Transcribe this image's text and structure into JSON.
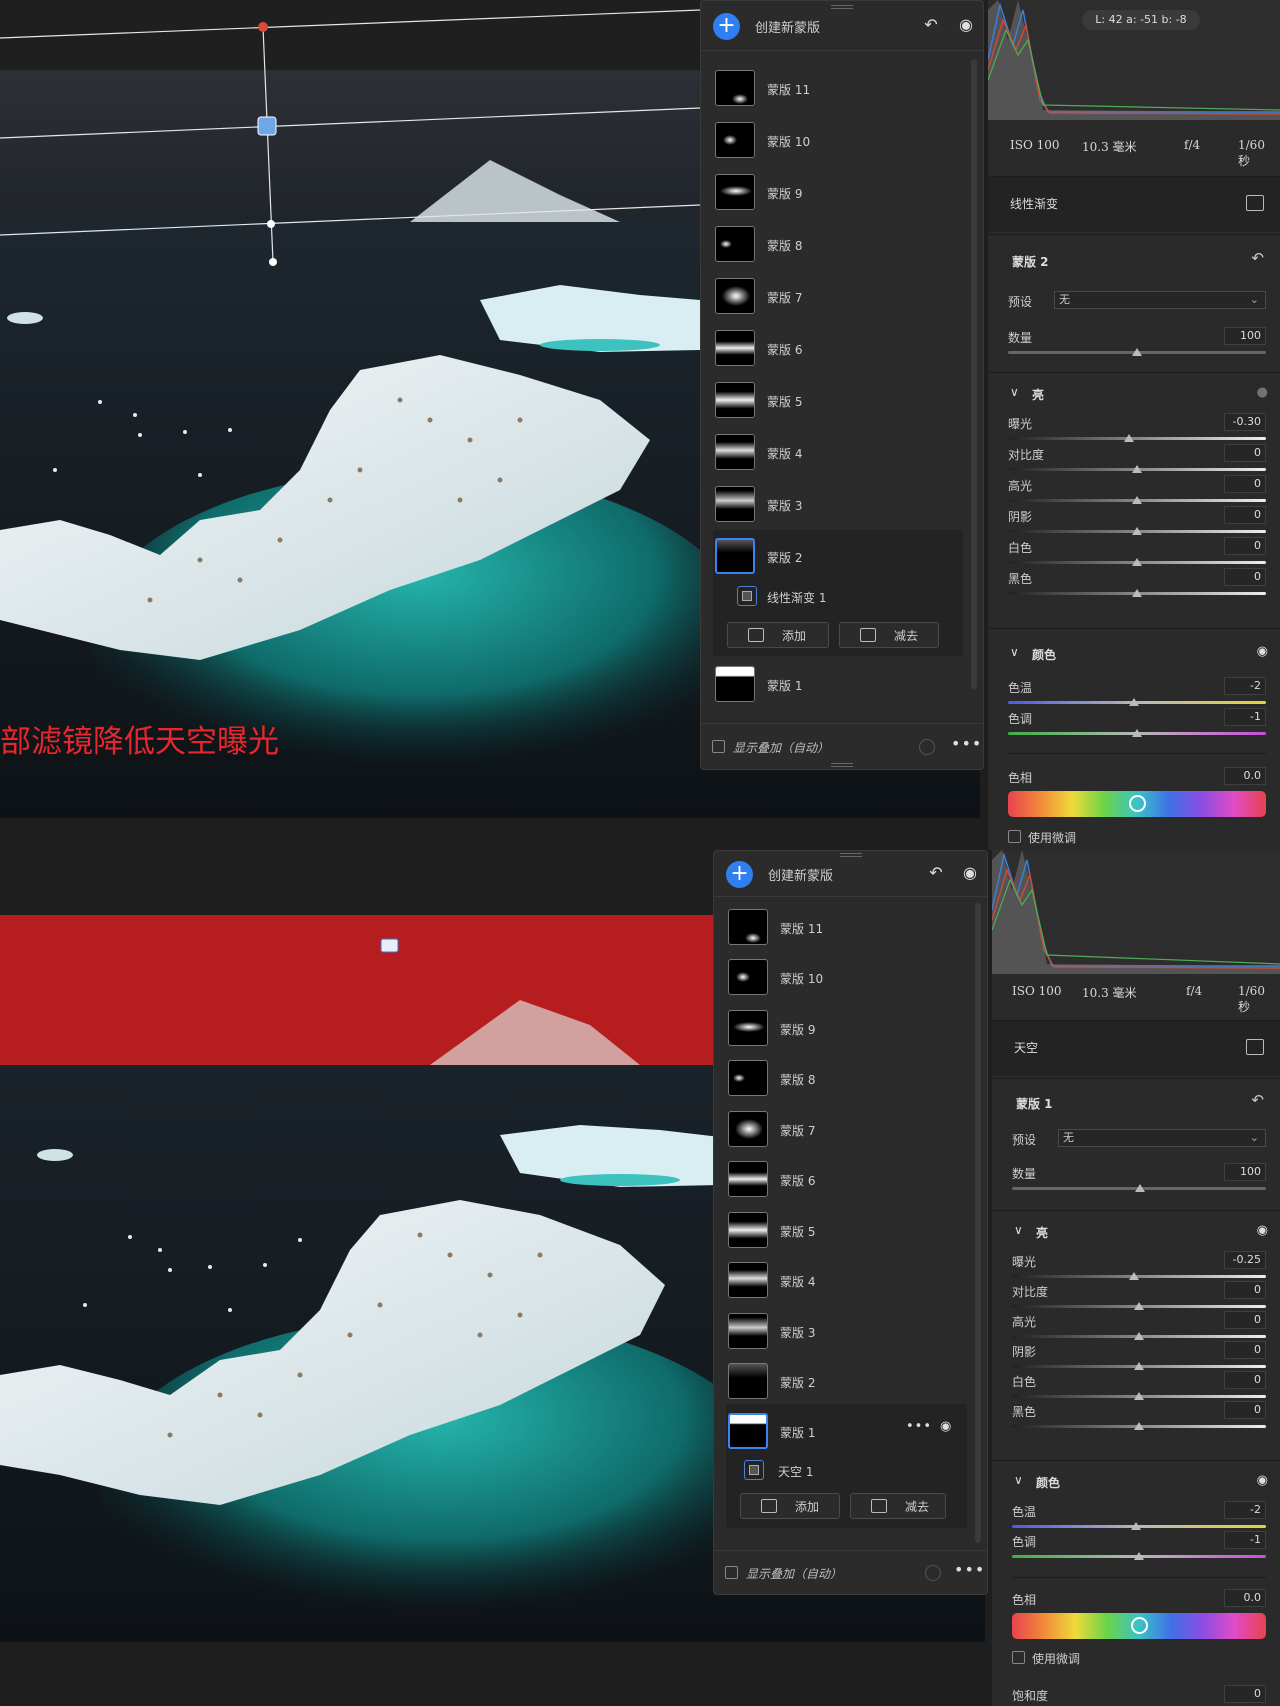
{
  "top": {
    "caption": "部滤镜降低天空曝光",
    "mask_panel": {
      "title": "创建新蒙版",
      "masks": [
        "蒙版 11",
        "蒙版 10",
        "蒙版 9",
        "蒙版 8",
        "蒙版 7",
        "蒙版 6",
        "蒙版 5",
        "蒙版 4",
        "蒙版 3",
        "蒙版 2",
        "蒙版 1"
      ],
      "selected_mask": "蒙版 2",
      "sub_item": "线性渐变 1",
      "add_label": "添加",
      "subtract_label": "减去",
      "overlay_label": "显示叠加（自动）"
    },
    "right": {
      "lab_readout": "L: 42   a: -51   b: -8",
      "exif": {
        "iso": "ISO 100",
        "focal": "10.3 毫米",
        "aperture": "f/4",
        "shutter": "1/60 秒"
      },
      "tool_name": "线性渐变",
      "mask_name": "蒙版 2",
      "preset_label": "预设",
      "preset_value": "无",
      "amount_label": "数量",
      "amount_value": "100",
      "light_section": "亮",
      "light": [
        {
          "label": "曝光",
          "value": "-0.30",
          "pos": 0.47
        },
        {
          "label": "对比度",
          "value": "0",
          "pos": 0.5
        },
        {
          "label": "高光",
          "value": "0",
          "pos": 0.5
        },
        {
          "label": "阴影",
          "value": "0",
          "pos": 0.5
        },
        {
          "label": "白色",
          "value": "0",
          "pos": 0.5
        },
        {
          "label": "黑色",
          "value": "0",
          "pos": 0.5
        }
      ],
      "color_section": "颜色",
      "color": [
        {
          "label": "色温",
          "value": "-2",
          "pos": 0.49
        },
        {
          "label": "色调",
          "value": "-1",
          "pos": 0.5
        }
      ],
      "hue_label": "色相",
      "hue_value": "0.0",
      "fine_tune_label": "使用微调"
    }
  },
  "bottom": {
    "mask_panel": {
      "title": "创建新蒙版",
      "masks": [
        "蒙版 11",
        "蒙版 10",
        "蒙版 9",
        "蒙版 8",
        "蒙版 7",
        "蒙版 6",
        "蒙版 5",
        "蒙版 4",
        "蒙版 3",
        "蒙版 2",
        "蒙版 1"
      ],
      "selected_mask": "蒙版 1",
      "sub_item": "天空 1",
      "add_label": "添加",
      "subtract_label": "减去",
      "overlay_label": "显示叠加（自动）"
    },
    "right": {
      "exif": {
        "iso": "ISO 100",
        "focal": "10.3 毫米",
        "aperture": "f/4",
        "shutter": "1/60 秒"
      },
      "tool_name": "天空",
      "mask_name": "蒙版 1",
      "preset_label": "预设",
      "preset_value": "无",
      "amount_label": "数量",
      "amount_value": "100",
      "light_section": "亮",
      "light": [
        {
          "label": "曝光",
          "value": "-0.25",
          "pos": 0.48
        },
        {
          "label": "对比度",
          "value": "0",
          "pos": 0.5
        },
        {
          "label": "高光",
          "value": "0",
          "pos": 0.5
        },
        {
          "label": "阴影",
          "value": "0",
          "pos": 0.5
        },
        {
          "label": "白色",
          "value": "0",
          "pos": 0.5
        },
        {
          "label": "黑色",
          "value": "0",
          "pos": 0.5
        }
      ],
      "color_section": "颜色",
      "color": [
        {
          "label": "色温",
          "value": "-2",
          "pos": 0.49
        },
        {
          "label": "色调",
          "value": "-1",
          "pos": 0.5
        }
      ],
      "hue_label": "色相",
      "hue_value": "0.0",
      "fine_tune_label": "使用微调",
      "saturation_label": "饱和度",
      "saturation_value": "0"
    }
  },
  "colors": {
    "accent": "#2f7ff0",
    "sky_overlay": "#b51d1f",
    "caption": "#e8262b",
    "panel": "#2b2b2b"
  },
  "icons": [
    "plus-icon",
    "undo-icon",
    "eye-icon",
    "chevron-down-icon",
    "more-icon",
    "linear-gradient-icon",
    "sky-icon"
  ]
}
